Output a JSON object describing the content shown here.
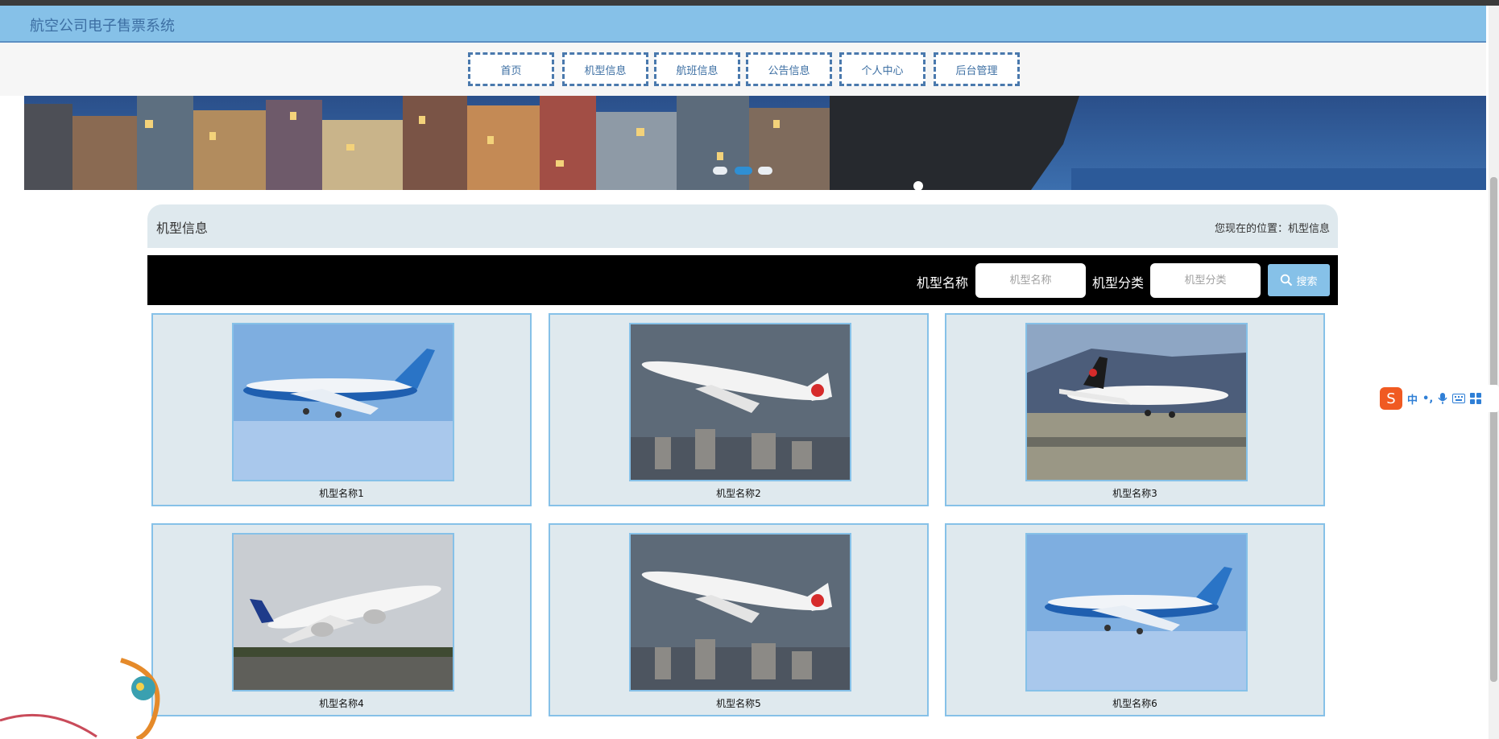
{
  "app": {
    "title": "航空公司电子售票系统"
  },
  "nav": {
    "items": [
      "首页",
      "机型信息",
      "航班信息",
      "公告信息",
      "个人中心",
      "后台管理"
    ]
  },
  "section": {
    "title": "机型信息",
    "breadcrumb": "您现在的位置：机型信息"
  },
  "search": {
    "name_label": "机型名称",
    "name_placeholder": "机型名称",
    "category_label": "机型分类",
    "category_placeholder": "机型分类",
    "button_label": "搜索",
    "button_icon": "search-icon"
  },
  "cards": [
    {
      "name": "机型名称1",
      "image": "blue-boeing-747-sky"
    },
    {
      "name": "机型名称2",
      "image": "air-china-747-city"
    },
    {
      "name": "机型名称3",
      "image": "air-canada-787-landing"
    },
    {
      "name": "机型名称4",
      "image": "air-france-777-takeoff"
    },
    {
      "name": "机型名称5",
      "image": "air-china-747-city"
    },
    {
      "name": "机型名称6",
      "image": "blue-boeing-747-sky"
    }
  ],
  "ime": {
    "labels": [
      "中",
      "•,"
    ]
  },
  "colors": {
    "header": "#86c1e8",
    "nav_border": "#4a79ad",
    "card_bg": "#dfe9ee",
    "search_bar": "#000000"
  }
}
